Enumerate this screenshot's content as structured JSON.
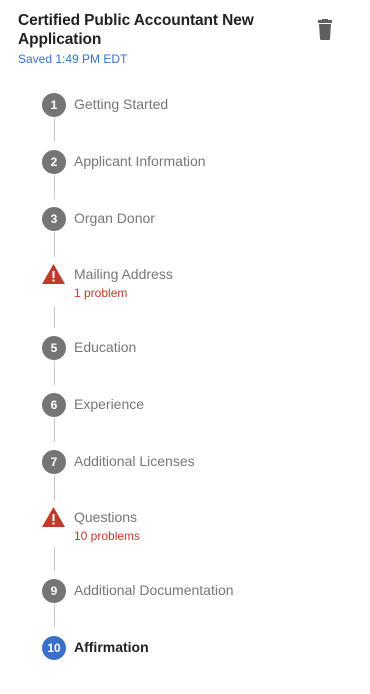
{
  "header": {
    "title": "Certified Public Accountant New Application",
    "saved": "Saved 1:49 PM EDT",
    "delete_icon": "trash-icon"
  },
  "steps": [
    {
      "number": "1",
      "label": "Getting Started",
      "status": "default"
    },
    {
      "number": "2",
      "label": "Applicant Information",
      "status": "default"
    },
    {
      "number": "3",
      "label": "Organ Donor",
      "status": "default"
    },
    {
      "number": "",
      "label": "Mailing Address",
      "status": "error",
      "problem": "1 problem",
      "icon": "warning-icon"
    },
    {
      "number": "5",
      "label": "Education",
      "status": "default"
    },
    {
      "number": "6",
      "label": "Experience",
      "status": "default"
    },
    {
      "number": "7",
      "label": "Additional Licenses",
      "status": "default"
    },
    {
      "number": "",
      "label": "Questions",
      "status": "error",
      "problem": "10 problems",
      "icon": "warning-icon"
    },
    {
      "number": "9",
      "label": "Additional Documentation",
      "status": "default"
    },
    {
      "number": "10",
      "label": "Affirmation",
      "status": "active"
    }
  ],
  "colors": {
    "badge_default": "#757575",
    "badge_active": "#3a6fc9",
    "error": "#c0392b",
    "saved_text": "#3a6fc9"
  }
}
